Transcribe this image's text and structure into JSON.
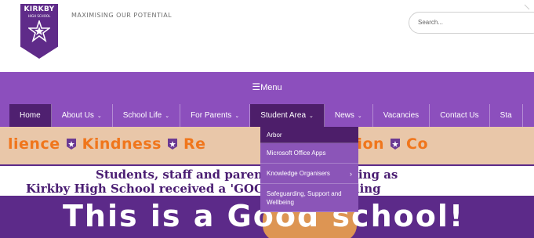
{
  "header": {
    "logo_line1": "KIRKBY",
    "logo_line2": "HIGH SCHOOL",
    "tagline": "MAXIMISING OUR POTENTIAL",
    "search_placeholder": "Search..."
  },
  "menu": {
    "icon": "hamburger-icon",
    "label": "Menu"
  },
  "nav": {
    "items": [
      {
        "label": "Home",
        "has_caret": false
      },
      {
        "label": "About Us",
        "has_caret": true
      },
      {
        "label": "School Life",
        "has_caret": true
      },
      {
        "label": "For Parents",
        "has_caret": true
      },
      {
        "label": "Student Area",
        "has_caret": true
      },
      {
        "label": "News",
        "has_caret": true
      },
      {
        "label": "Vacancies",
        "has_caret": false
      },
      {
        "label": "Contact Us",
        "has_caret": false
      },
      {
        "label": "Sta",
        "has_caret": false
      }
    ]
  },
  "dropdown": {
    "items": [
      {
        "label": "Arbor"
      },
      {
        "label": "Microsoft Office Apps"
      },
      {
        "label": "Knowledge Organisers",
        "submenu_arrow": "›"
      },
      {
        "label": "Safeguarding, Support and Wellbeing"
      }
    ]
  },
  "banner": {
    "values_parts": [
      "lience",
      "Kindness",
      "Re",
      "Aspiration",
      "Co"
    ],
    "announce_line1": "Students, staff and parents are celebrating as",
    "announce_line2": "Kirkby High School received a 'GOOD' Ofsted grading",
    "headline": "This is a Good school!"
  },
  "colors": {
    "brand_purple": "#8c4fbd",
    "active_tab": "#4f2070",
    "values_orange": "#f0761c",
    "announce_purple": "#4a1d72"
  }
}
